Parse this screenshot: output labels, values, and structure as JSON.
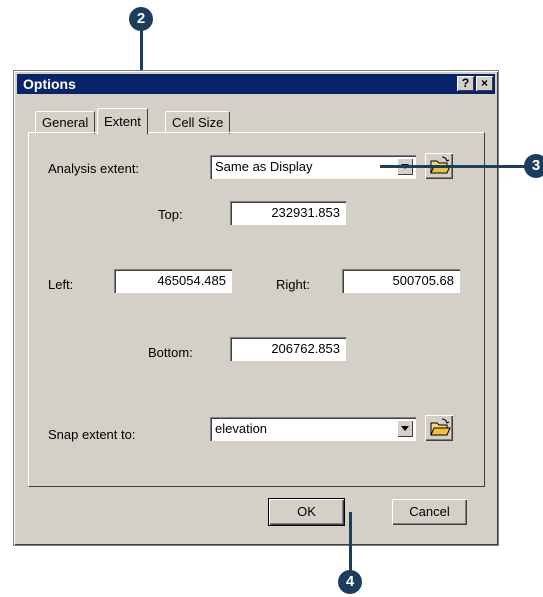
{
  "dialog": {
    "title": "Options",
    "help_button": "?",
    "close_button": "×"
  },
  "tabs": [
    {
      "label": "General"
    },
    {
      "label": "Extent"
    },
    {
      "label": "Cell Size"
    }
  ],
  "analysis_extent": {
    "label": "Analysis extent:",
    "value": "Same as Display"
  },
  "extent": {
    "top_label": "Top:",
    "top_value": "232931.853",
    "left_label": "Left:",
    "left_value": "465054.485",
    "right_label": "Right:",
    "right_value": "500705.68",
    "bottom_label": "Bottom:",
    "bottom_value": "206762.853"
  },
  "snap_extent": {
    "label": "Snap extent to:",
    "value": "elevation"
  },
  "buttons": {
    "ok": "OK",
    "cancel": "Cancel"
  },
  "callouts": {
    "two": "2",
    "three": "3",
    "four": "4"
  },
  "colors": {
    "callout": "#1d3d5c",
    "titlebar": "#0a246a",
    "dialog_face": "#d4d0c8"
  }
}
